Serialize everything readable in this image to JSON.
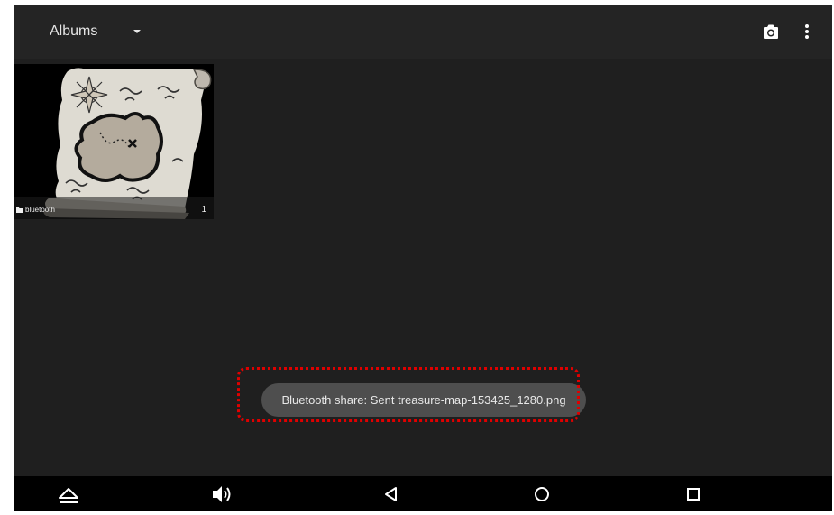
{
  "action_bar": {
    "title": "Albums",
    "icons": [
      "camera-icon",
      "overflow-menu-icon"
    ]
  },
  "albums": [
    {
      "name": "bluetooth",
      "count": "1",
      "thumbnail": "treasure-map"
    }
  ],
  "toast": {
    "message": "Bluetooth share: Sent treasure-map-153425_1280.png"
  },
  "nav_bar": {
    "icons": [
      "collapse-icon",
      "volume-icon",
      "back-icon",
      "home-icon",
      "recents-icon"
    ]
  },
  "colors": {
    "background": "#1f1f1f",
    "action_bar": "#242424",
    "toast": "#4e4e4e",
    "highlight": "#e00000"
  }
}
